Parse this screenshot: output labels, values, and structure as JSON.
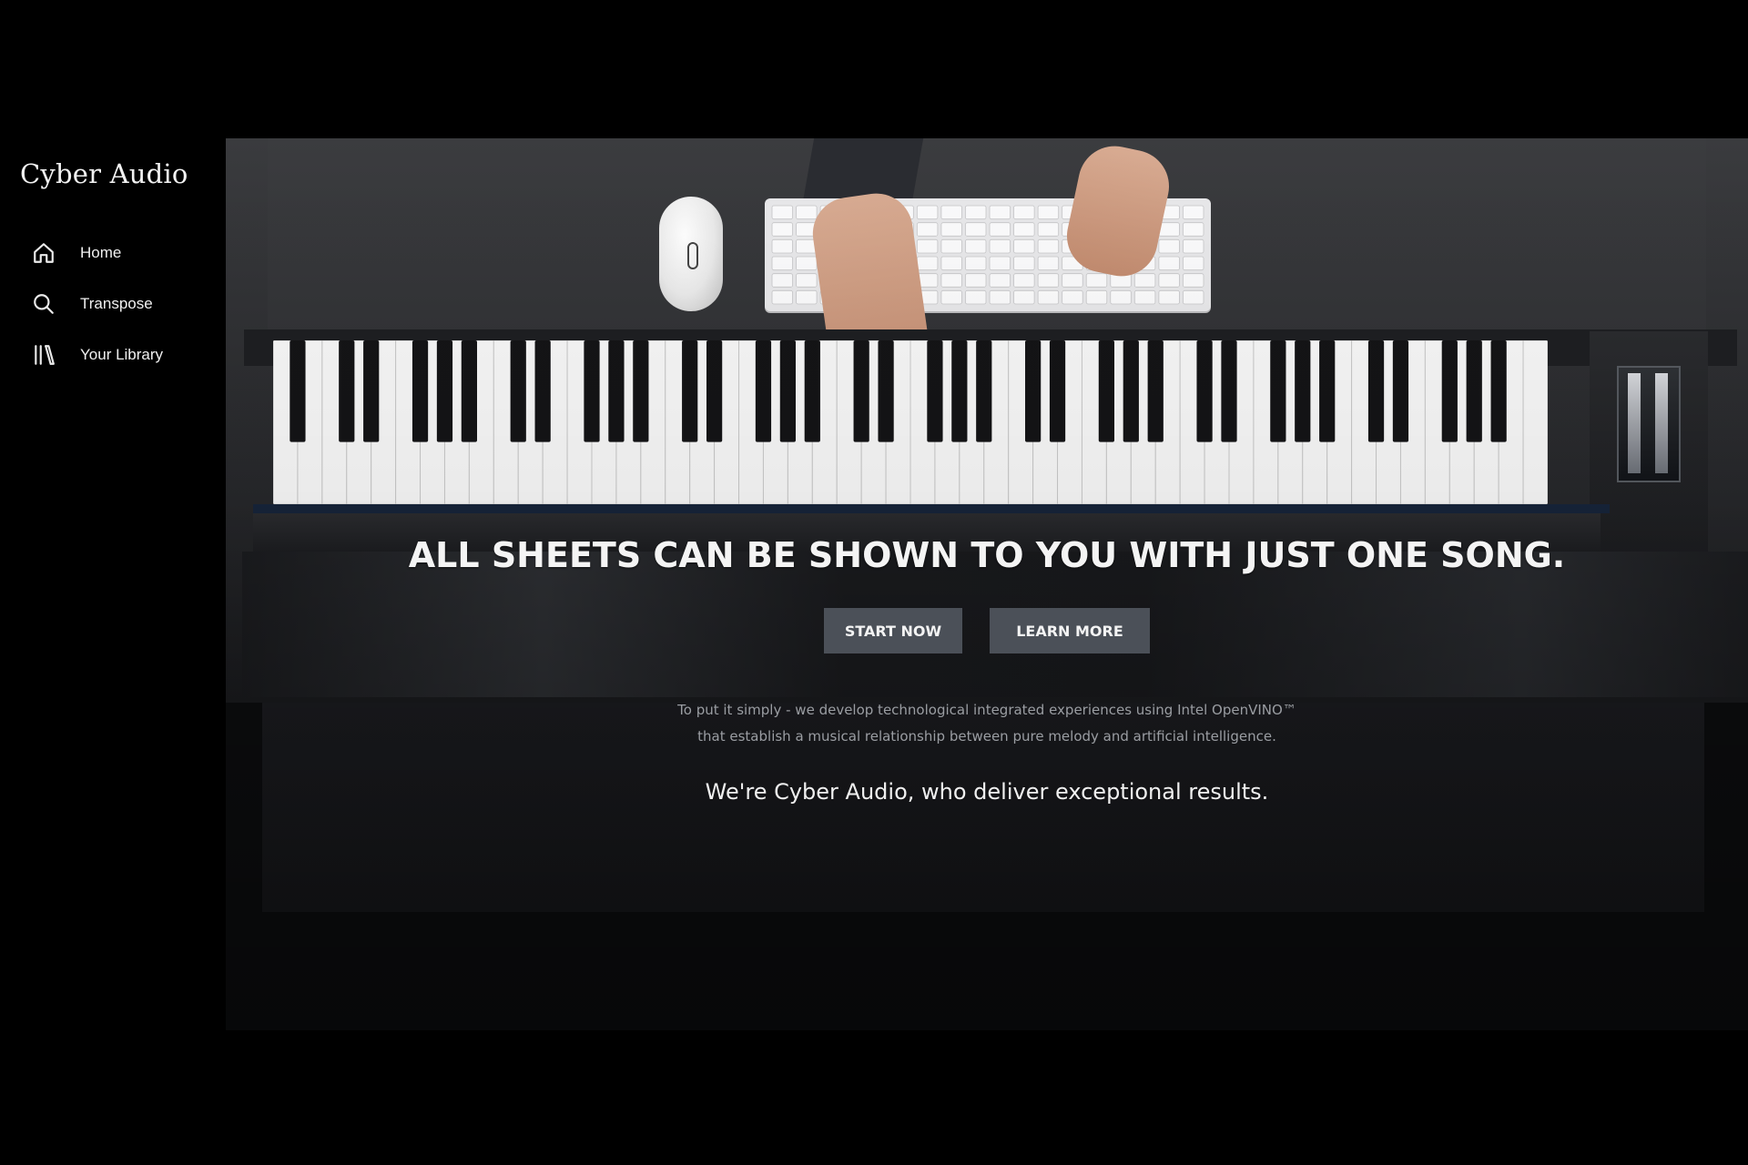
{
  "brand": {
    "name": "Cyber Audio"
  },
  "sidebar": {
    "items": [
      {
        "label": "Home",
        "icon": "home-icon"
      },
      {
        "label": "Transpose",
        "icon": "search-icon"
      },
      {
        "label": "Your Library",
        "icon": "library-icon"
      }
    ]
  },
  "hero": {
    "headline": "ALL SHEETS CAN BE SHOWN TO YOU WITH JUST ONE SONG.",
    "buttons": {
      "start_label": "START NOW",
      "learn_label": "LEARN MORE"
    },
    "description_line1": "To put it simply - we develop technological integrated experiences using Intel OpenVINO™",
    "description_line2": "that establish a musical relationship between pure melody and artificial intelligence.",
    "tagline": "We're Cyber Audio, who deliver exceptional results."
  },
  "colors": {
    "background": "#000000",
    "button": "#4b5058",
    "text": "#f4f4f4",
    "muted_text": "#9a9da2"
  }
}
